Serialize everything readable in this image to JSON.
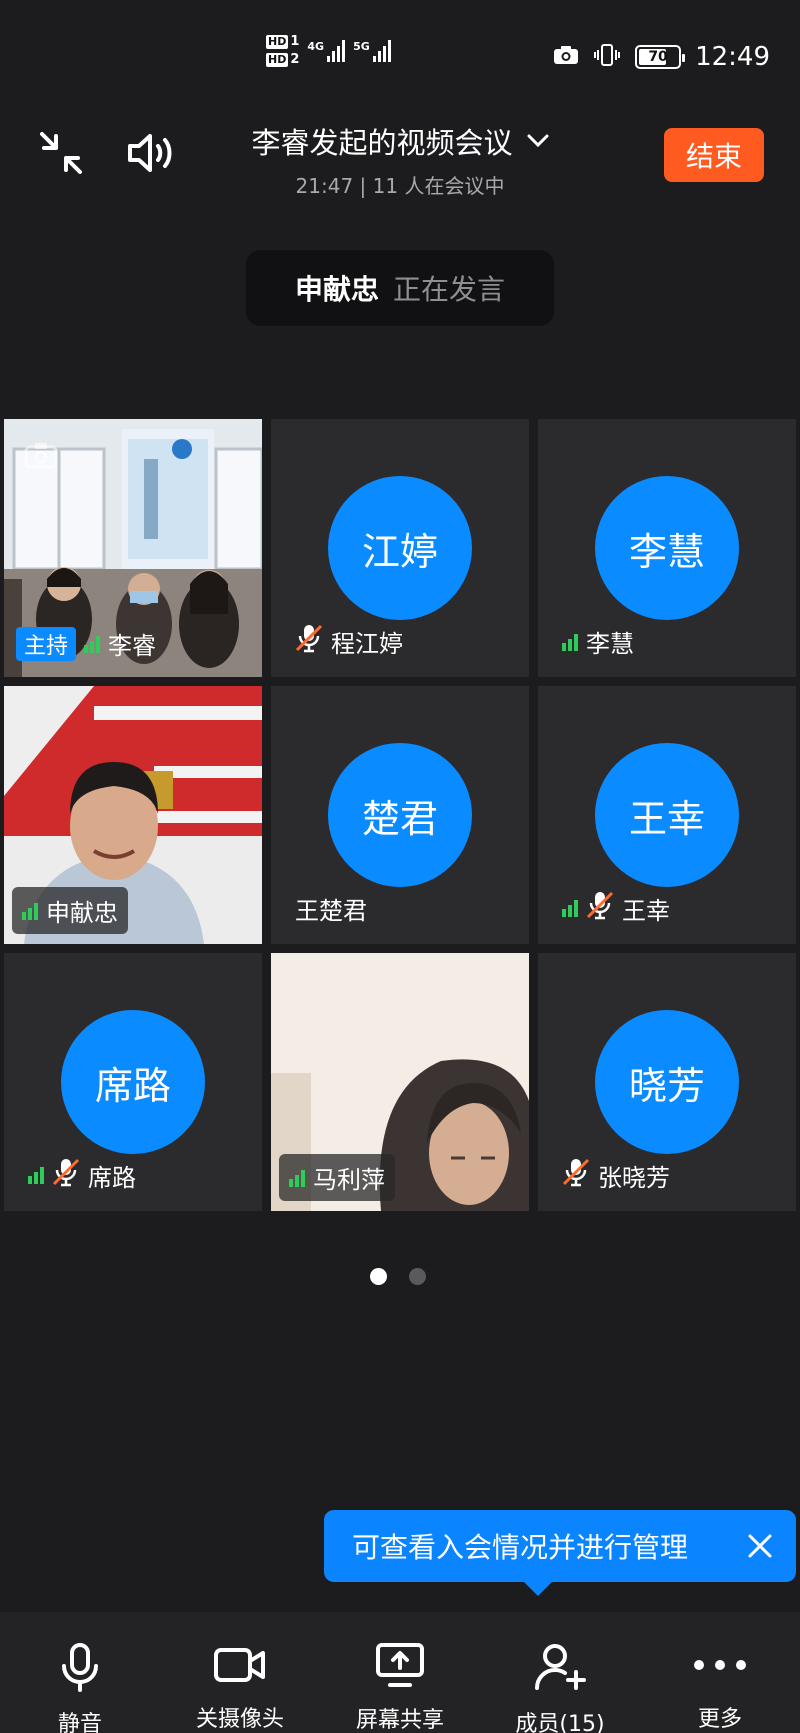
{
  "status_bar": {
    "hd1": "HD",
    "hd1_num": "1",
    "hd2": "HD",
    "hd2_num": "2",
    "net1": "4G",
    "net2": "5G",
    "battery": "70",
    "battery_level": 0.7,
    "time": "12:49"
  },
  "header": {
    "title": "李睿发起的视频会议",
    "subtitle": "21:47 | 11 人在会议中",
    "end_label": "结束"
  },
  "speaking": {
    "name": "申献忠",
    "status": "正在发言"
  },
  "participants": [
    {
      "name": "李睿",
      "avatar_text": "",
      "host_label": "主持",
      "video": "classroom",
      "muted": false,
      "signal": true
    },
    {
      "name": "程江婷",
      "avatar_text": "江婷",
      "muted": true,
      "signal": false
    },
    {
      "name": "李慧",
      "avatar_text": "李慧",
      "muted": false,
      "signal": true
    },
    {
      "name": "申献忠",
      "avatar_text": "",
      "video": "office",
      "muted": false,
      "signal": true,
      "active_speaker": true
    },
    {
      "name": "王楚君",
      "avatar_text": "楚君",
      "muted": false,
      "signal": false
    },
    {
      "name": "王幸",
      "avatar_text": "王幸",
      "muted": true,
      "signal": true
    },
    {
      "name": "席路",
      "avatar_text": "席路",
      "muted": true,
      "signal": true
    },
    {
      "name": "马利萍",
      "avatar_text": "",
      "video": "home",
      "muted": false,
      "signal": true
    },
    {
      "name": "张晓芳",
      "avatar_text": "晓芳",
      "muted": true,
      "signal": false
    }
  ],
  "pager": {
    "pages": 2,
    "current": 1
  },
  "tooltip": {
    "text": "可查看入会情况并进行管理"
  },
  "toolbar": {
    "mute": "静音",
    "camera": "关摄像头",
    "share": "屏幕共享",
    "members": "成员(15)",
    "more": "更多"
  },
  "colors": {
    "accent": "#0a8bff",
    "end_button": "#ff5a1f",
    "active_border": "#1fb24a",
    "signal": "#2fcc5a",
    "mute_slash": "#ff6b2c"
  }
}
